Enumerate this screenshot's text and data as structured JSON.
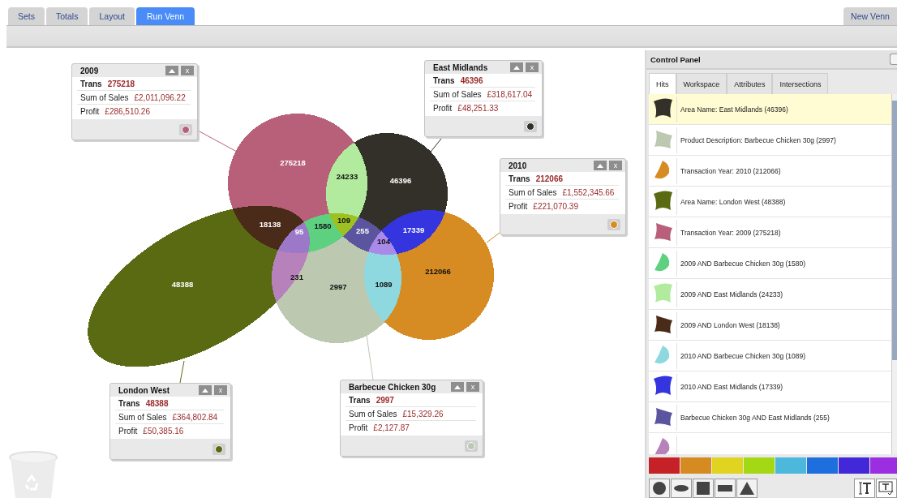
{
  "tabs": [
    {
      "label": "Sets",
      "selected": false
    },
    {
      "label": "Totals",
      "selected": false
    },
    {
      "label": "Layout",
      "selected": false
    },
    {
      "label": "Run Venn",
      "selected": true
    }
  ],
  "new_venn_button": "New Venn",
  "venn": {
    "sets": [
      {
        "title": "2009",
        "count": "275218",
        "color": "#b86079",
        "close": "x",
        "rows": [
          {
            "label": "Trans",
            "value": "275218"
          },
          {
            "label": "Sum of Sales",
            "value": "£2,011,096.22"
          },
          {
            "label": "Profit",
            "value": "£286,510.26"
          }
        ]
      },
      {
        "title": "East Midlands",
        "count": "46396",
        "color": "#33302a",
        "close": "x",
        "rows": [
          {
            "label": "Trans",
            "value": "46396"
          },
          {
            "label": "Sum of Sales",
            "value": "£318,617.04"
          },
          {
            "label": "Profit",
            "value": "£48,251.33"
          }
        ]
      },
      {
        "title": "2010",
        "count": "212066",
        "color": "#d68c22",
        "close": "x",
        "rows": [
          {
            "label": "Trans",
            "value": "212066"
          },
          {
            "label": "Sum of Sales",
            "value": "£1,552,345.66"
          },
          {
            "label": "Profit",
            "value": "£221,070.39"
          }
        ]
      },
      {
        "title": "London West",
        "count": "48388",
        "color": "#5a6a12",
        "close": "x",
        "rows": [
          {
            "label": "Trans",
            "value": "48388"
          },
          {
            "label": "Sum of Sales",
            "value": "£364,802.84"
          },
          {
            "label": "Profit",
            "value": "£50,385.16"
          }
        ]
      },
      {
        "title": "Barbecue Chicken 30g",
        "count": "2997",
        "color": "#bcc8b0",
        "close": "x",
        "rows": [
          {
            "label": "Trans",
            "value": "2997"
          },
          {
            "label": "Sum of Sales",
            "value": "£15,329.26"
          },
          {
            "label": "Profit",
            "value": "£2,127.87"
          }
        ]
      }
    ],
    "intersections": [
      {
        "count": "24233",
        "color": "#b2eb9e"
      },
      {
        "count": "18138",
        "color": "#4a2a18"
      },
      {
        "count": "95",
        "color": "#9b78c8"
      },
      {
        "count": "1580",
        "color": "#5dd17f"
      },
      {
        "count": "109",
        "color": "#9dc023"
      },
      {
        "count": "255",
        "color": "#5b55a0"
      },
      {
        "count": "104",
        "color": "#a98ae8"
      },
      {
        "count": "17339",
        "color": "#3535e0"
      },
      {
        "count": "231",
        "color": "#b781bb"
      },
      {
        "count": "1089",
        "color": "#8ed9e0"
      }
    ]
  },
  "control_panel": {
    "title": "Control Panel",
    "tabs": [
      {
        "label": "Hits",
        "selected": true
      },
      {
        "label": "Workspace",
        "selected": false
      },
      {
        "label": "Attributes",
        "selected": false
      },
      {
        "label": "Intersections",
        "selected": false
      }
    ],
    "hits": [
      {
        "label": "Area Name: East Midlands (46396)",
        "color": "#33302a",
        "selected": true
      },
      {
        "label": "Product Description: Barbecue Chicken 30g (2997)",
        "color": "#bcc8b0",
        "selected": false
      },
      {
        "label": "Transaction Year: 2010 (212066)",
        "color": "#d68c22",
        "selected": false
      },
      {
        "label": "Area Name: London West (48388)",
        "color": "#5a6a12",
        "selected": false
      },
      {
        "label": "Transaction Year: 2009 (275218)",
        "color": "#b86079",
        "selected": false
      },
      {
        "label": "2009 AND Barbecue Chicken 30g (1580)",
        "color": "#5dd17f",
        "selected": false
      },
      {
        "label": "2009 AND East Midlands (24233)",
        "color": "#b2eb9e",
        "selected": false
      },
      {
        "label": "2009 AND London West (18138)",
        "color": "#4a2a18",
        "selected": false
      },
      {
        "label": "2010 AND Barbecue Chicken 30g (1089)",
        "color": "#8ed9e0",
        "selected": false
      },
      {
        "label": "2010 AND East Midlands (17339)",
        "color": "#3535e0",
        "selected": false
      },
      {
        "label": "Barbecue Chicken 30g AND East Midlands (255)",
        "color": "#5b55a0",
        "selected": false
      },
      {
        "color": "#b781bb",
        "selected": false
      }
    ],
    "palette": [
      {
        "color": "#c62127"
      },
      {
        "color": "#d68a22"
      },
      {
        "color": "#e0d420"
      },
      {
        "color": "#a4d814"
      },
      {
        "color": "#4cb8dc"
      },
      {
        "color": "#1e6ede"
      },
      {
        "color": "#4228d8"
      },
      {
        "color": "#9a2ee0"
      }
    ],
    "shape_tools": [
      {
        "kind": "circle"
      },
      {
        "kind": "ellipse"
      },
      {
        "kind": "square"
      },
      {
        "kind": "rectangle"
      },
      {
        "kind": "triangle"
      }
    ],
    "text_tools": [
      {
        "kind": "text"
      },
      {
        "kind": "text-edit"
      }
    ]
  }
}
